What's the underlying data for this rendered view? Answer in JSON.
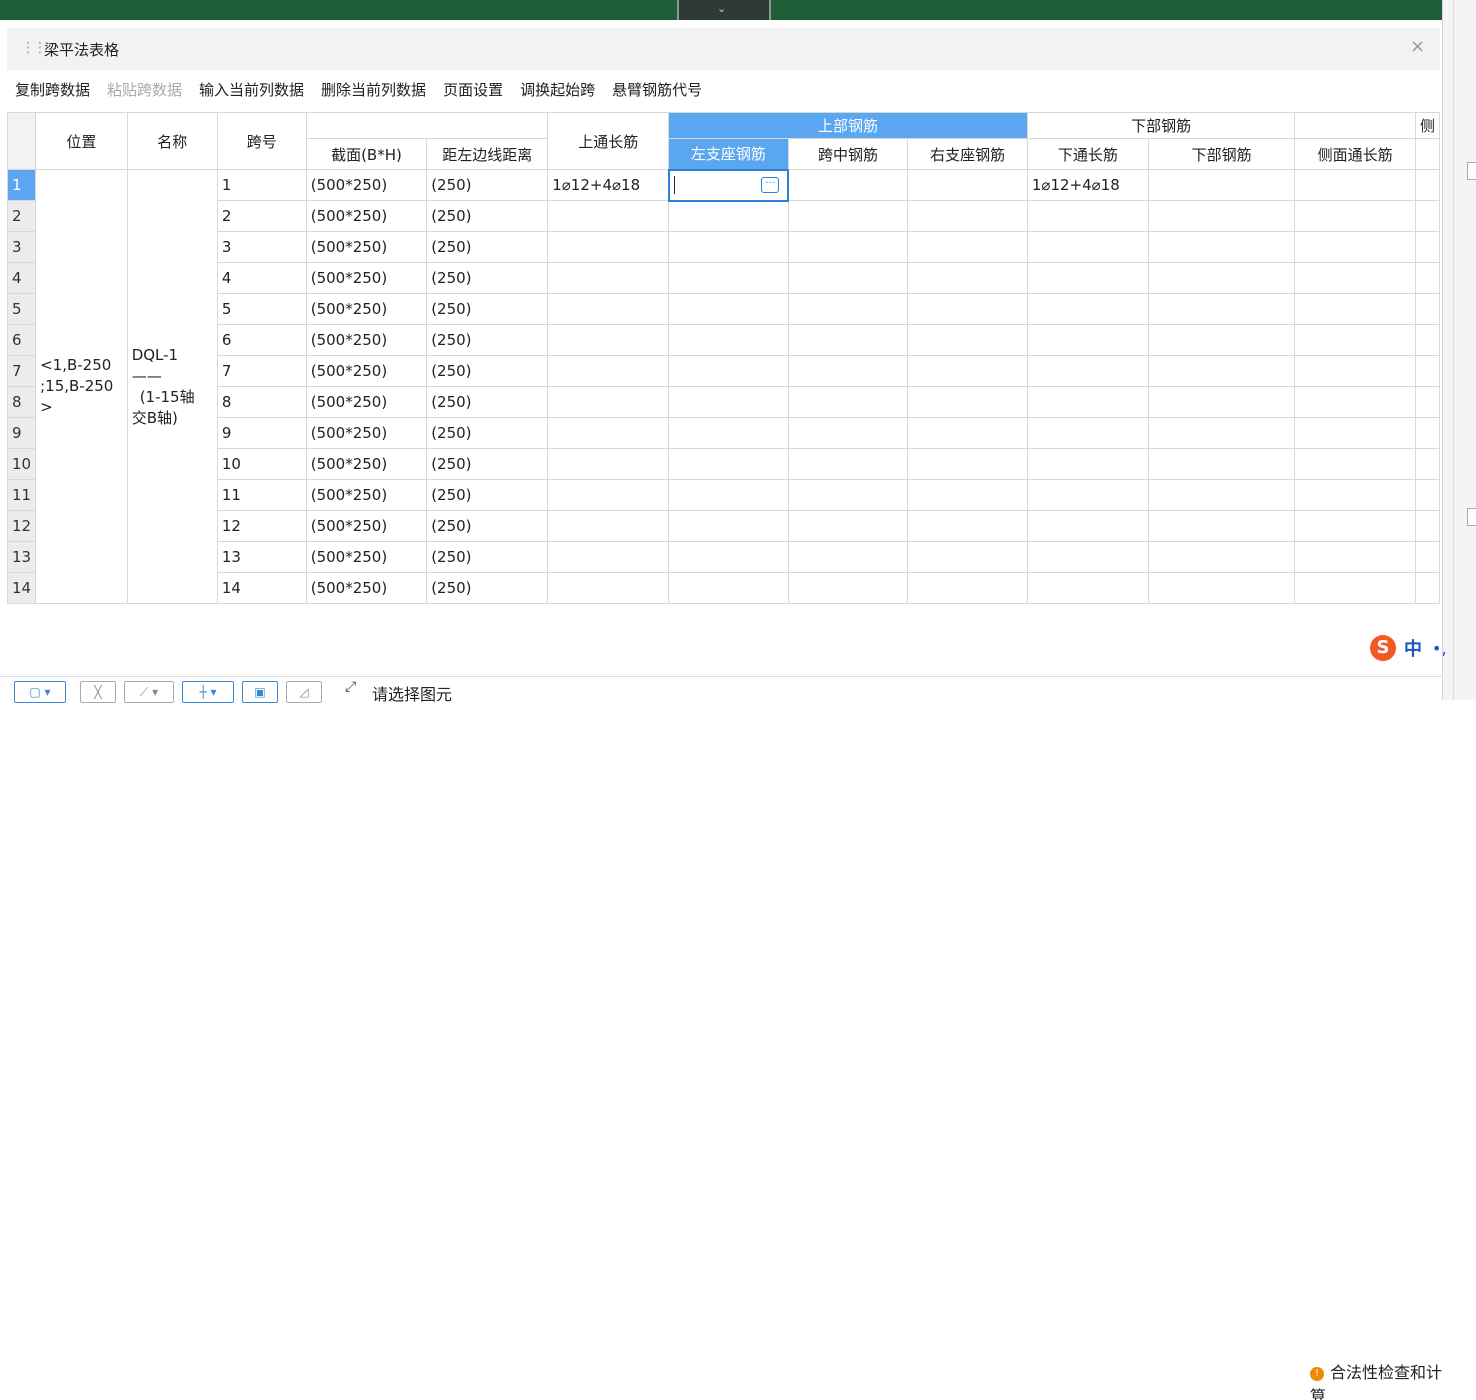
{
  "panel": {
    "title": "梁平法表格",
    "close_icon": "close-icon"
  },
  "toolbar": {
    "items": [
      "复制跨数据",
      "粘贴跨数据",
      "输入当前列数据",
      "删除当前列数据",
      "页面设置",
      "调换起始跨",
      "悬臂钢筋代号"
    ],
    "disabled": [
      "粘贴跨数据"
    ]
  },
  "table": {
    "headers": {
      "position": "位置",
      "name": "名称",
      "span": "跨号",
      "section": "截面(B*H)",
      "offset": "距左边线距离",
      "top_through": "上通长筋",
      "upper_group": "上部钢筋",
      "left_support": "左支座钢筋",
      "mid_span": "跨中钢筋",
      "right_support": "右支座钢筋",
      "lower_group": "下部钢筋",
      "bottom_through": "下通长筋",
      "bottom_rebar": "下部钢筋",
      "side_through": "侧面通长筋",
      "cut_col": "侧"
    },
    "position_value": "<1,B-250;15,B-250>",
    "position_lines": [
      "<1,B-250",
      ";15,B-250",
      ">"
    ],
    "name_lines": [
      "DQL-1",
      "——",
      "(1-15轴",
      "交B轴)"
    ],
    "rows": [
      {
        "num": "1",
        "span": "1",
        "section": "(500*250)",
        "offset": "(250)",
        "top_through": "1⌀12+4⌀18",
        "bottom_through": "1⌀12+4⌀18"
      },
      {
        "num": "2",
        "span": "2",
        "section": "(500*250)",
        "offset": "(250)",
        "top_through": "",
        "bottom_through": ""
      },
      {
        "num": "3",
        "span": "3",
        "section": "(500*250)",
        "offset": "(250)",
        "top_through": "",
        "bottom_through": ""
      },
      {
        "num": "4",
        "span": "4",
        "section": "(500*250)",
        "offset": "(250)",
        "top_through": "",
        "bottom_through": ""
      },
      {
        "num": "5",
        "span": "5",
        "section": "(500*250)",
        "offset": "(250)",
        "top_through": "",
        "bottom_through": ""
      },
      {
        "num": "6",
        "span": "6",
        "section": "(500*250)",
        "offset": "(250)",
        "top_through": "",
        "bottom_through": ""
      },
      {
        "num": "7",
        "span": "7",
        "section": "(500*250)",
        "offset": "(250)",
        "top_through": "",
        "bottom_through": ""
      },
      {
        "num": "8",
        "span": "8",
        "section": "(500*250)",
        "offset": "(250)",
        "top_through": "",
        "bottom_through": ""
      },
      {
        "num": "9",
        "span": "9",
        "section": "(500*250)",
        "offset": "(250)",
        "top_through": "",
        "bottom_through": ""
      },
      {
        "num": "10",
        "span": "10",
        "section": "(500*250)",
        "offset": "(250)",
        "top_through": "",
        "bottom_through": ""
      },
      {
        "num": "11",
        "span": "11",
        "section": "(500*250)",
        "offset": "(250)",
        "top_through": "",
        "bottom_through": ""
      },
      {
        "num": "12",
        "span": "12",
        "section": "(500*250)",
        "offset": "(250)",
        "top_through": "",
        "bottom_through": ""
      },
      {
        "num": "13",
        "span": "13",
        "section": "(500*250)",
        "offset": "(250)",
        "top_through": "",
        "bottom_through": ""
      },
      {
        "num": "14",
        "span": "14",
        "section": "(500*250)",
        "offset": "(250)",
        "top_through": "",
        "bottom_through": ""
      }
    ]
  },
  "bottom_bar": {
    "select_label": "请选择图元",
    "check_label": "合法性检查和计算"
  },
  "ime": {
    "logo": "S",
    "lang": "中",
    "dot": "•,"
  },
  "colors": {
    "top_bar": "#1d5e39",
    "header_selected": "#5aa6f0",
    "active_border": "#2f7fd6"
  }
}
